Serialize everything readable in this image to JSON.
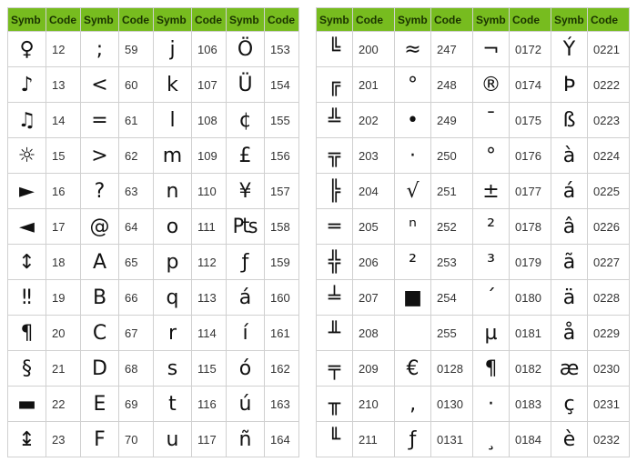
{
  "headers": {
    "symb": "Symb",
    "code": "Code"
  },
  "left": {
    "cols": 4,
    "rows": [
      [
        {
          "s": "♀",
          "c": "12"
        },
        {
          "s": ";",
          "c": "59"
        },
        {
          "s": "j",
          "c": "106"
        },
        {
          "s": "Ö",
          "c": "153"
        }
      ],
      [
        {
          "s": "♪",
          "c": "13"
        },
        {
          "s": "<",
          "c": "60"
        },
        {
          "s": "k",
          "c": "107"
        },
        {
          "s": "Ü",
          "c": "154"
        }
      ],
      [
        {
          "s": "♫",
          "c": "14"
        },
        {
          "s": "=",
          "c": "61"
        },
        {
          "s": "l",
          "c": "108"
        },
        {
          "s": "¢",
          "c": "155"
        }
      ],
      [
        {
          "s": "☼",
          "c": "15"
        },
        {
          "s": ">",
          "c": "62"
        },
        {
          "s": "m",
          "c": "109"
        },
        {
          "s": "£",
          "c": "156"
        }
      ],
      [
        {
          "s": "►",
          "c": "16"
        },
        {
          "s": "?",
          "c": "63"
        },
        {
          "s": "n",
          "c": "110"
        },
        {
          "s": "¥",
          "c": "157"
        }
      ],
      [
        {
          "s": "◄",
          "c": "17"
        },
        {
          "s": "@",
          "c": "64"
        },
        {
          "s": "o",
          "c": "111"
        },
        {
          "s": "₧",
          "c": "158"
        }
      ],
      [
        {
          "s": "↕",
          "c": "18"
        },
        {
          "s": "A",
          "c": "65"
        },
        {
          "s": "p",
          "c": "112"
        },
        {
          "s": "ƒ",
          "c": "159"
        }
      ],
      [
        {
          "s": "‼",
          "c": "19"
        },
        {
          "s": "B",
          "c": "66"
        },
        {
          "s": "q",
          "c": "113"
        },
        {
          "s": "á",
          "c": "160"
        }
      ],
      [
        {
          "s": "¶",
          "c": "20"
        },
        {
          "s": "C",
          "c": "67"
        },
        {
          "s": "r",
          "c": "114"
        },
        {
          "s": "í",
          "c": "161"
        }
      ],
      [
        {
          "s": "§",
          "c": "21"
        },
        {
          "s": "D",
          "c": "68"
        },
        {
          "s": "s",
          "c": "115"
        },
        {
          "s": "ó",
          "c": "162"
        }
      ],
      [
        {
          "s": "▬",
          "c": "22"
        },
        {
          "s": "E",
          "c": "69"
        },
        {
          "s": "t",
          "c": "116"
        },
        {
          "s": "ú",
          "c": "163"
        }
      ],
      [
        {
          "s": "↨",
          "c": "23"
        },
        {
          "s": "F",
          "c": "70"
        },
        {
          "s": "u",
          "c": "117"
        },
        {
          "s": "ñ",
          "c": "164"
        }
      ]
    ]
  },
  "right": {
    "cols": 4,
    "rows": [
      [
        {
          "s": "╚",
          "c": "200"
        },
        {
          "s": "≈",
          "c": "247"
        },
        {
          "s": "¬",
          "c": "0172"
        },
        {
          "s": "Ý",
          "c": "0221"
        }
      ],
      [
        {
          "s": "╔",
          "c": "201"
        },
        {
          "s": "°",
          "c": "248"
        },
        {
          "s": "®",
          "c": "0174"
        },
        {
          "s": "Þ",
          "c": "0222"
        }
      ],
      [
        {
          "s": "╩",
          "c": "202"
        },
        {
          "s": "•",
          "c": "249"
        },
        {
          "s": "¯",
          "c": "0175"
        },
        {
          "s": "ß",
          "c": "0223"
        }
      ],
      [
        {
          "s": "╦",
          "c": "203"
        },
        {
          "s": "·",
          "c": "250"
        },
        {
          "s": "°",
          "c": "0176"
        },
        {
          "s": "à",
          "c": "0224"
        }
      ],
      [
        {
          "s": "╠",
          "c": "204"
        },
        {
          "s": "√",
          "c": "251"
        },
        {
          "s": "±",
          "c": "0177"
        },
        {
          "s": "á",
          "c": "0225"
        }
      ],
      [
        {
          "s": "═",
          "c": "205"
        },
        {
          "s": "ⁿ",
          "c": "252"
        },
        {
          "s": "²",
          "c": "0178"
        },
        {
          "s": "â",
          "c": "0226"
        }
      ],
      [
        {
          "s": "╬",
          "c": "206"
        },
        {
          "s": "²",
          "c": "253"
        },
        {
          "s": "³",
          "c": "0179"
        },
        {
          "s": "ã",
          "c": "0227"
        }
      ],
      [
        {
          "s": "╧",
          "c": "207"
        },
        {
          "s": "■",
          "c": "254"
        },
        {
          "s": "´",
          "c": "0180"
        },
        {
          "s": "ä",
          "c": "0228"
        }
      ],
      [
        {
          "s": "╨",
          "c": "208"
        },
        {
          "s": "",
          "c": "255"
        },
        {
          "s": "µ",
          "c": "0181"
        },
        {
          "s": "å",
          "c": "0229"
        }
      ],
      [
        {
          "s": "╤",
          "c": "209"
        },
        {
          "s": "€",
          "c": "0128"
        },
        {
          "s": "¶",
          "c": "0182"
        },
        {
          "s": "æ",
          "c": "0230"
        }
      ],
      [
        {
          "s": "╥",
          "c": "210"
        },
        {
          "s": "‚",
          "c": "0130"
        },
        {
          "s": "·",
          "c": "0183"
        },
        {
          "s": "ç",
          "c": "0231"
        }
      ],
      [
        {
          "s": "╙",
          "c": "211"
        },
        {
          "s": "ƒ",
          "c": "0131"
        },
        {
          "s": "¸",
          "c": "0184"
        },
        {
          "s": "è",
          "c": "0232"
        }
      ]
    ]
  }
}
